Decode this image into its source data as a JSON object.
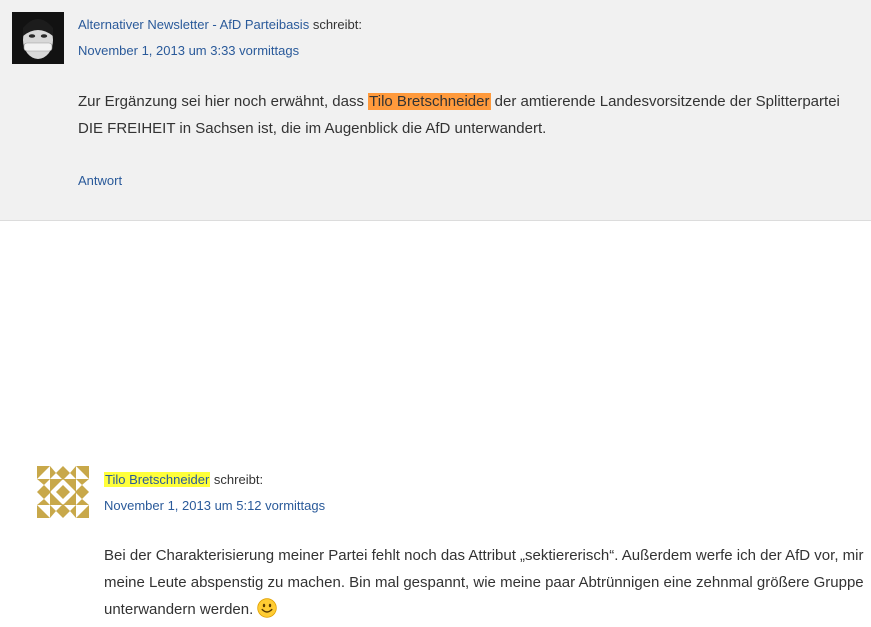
{
  "comments": [
    {
      "author": "Alternativer Newsletter - AfD Parteibasis",
      "says": "schreibt:",
      "date": "November 1, 2013 um 3:33 vormittags",
      "text_before": "Zur Ergänzung sei hier noch erwähnt, dass ",
      "highlight": "Tilo Bretschneider",
      "text_after": " der amtierende Landesvorsitzende der Splitterpartei DIE FREIHEIT in Sachsen ist, die im Augenblick die AfD unterwandert.",
      "reply": "Antwort",
      "highlight_color": "#ff9a3c"
    },
    {
      "author": "Tilo Bretschneider",
      "says": "schreibt:",
      "date": "November 1, 2013 um 5:12 vormittags",
      "text": "Bei der Charakterisierung meiner Partei fehlt noch das Attribut „sektiererisch“. Außerdem werfe ich der AfD vor, mir meine Leute abspenstig zu machen. Bin mal gespannt, wie meine paar Abtrünnigen eine zehnmal größere Gruppe unterwandern werden.",
      "emoji_icon": "smiley-icon",
      "highlight_color": "#ffff3a"
    }
  ],
  "colors": {
    "link": "#2a5a9a",
    "comment_bg": "#f1f1f1",
    "identicon": "#c8a84a"
  }
}
